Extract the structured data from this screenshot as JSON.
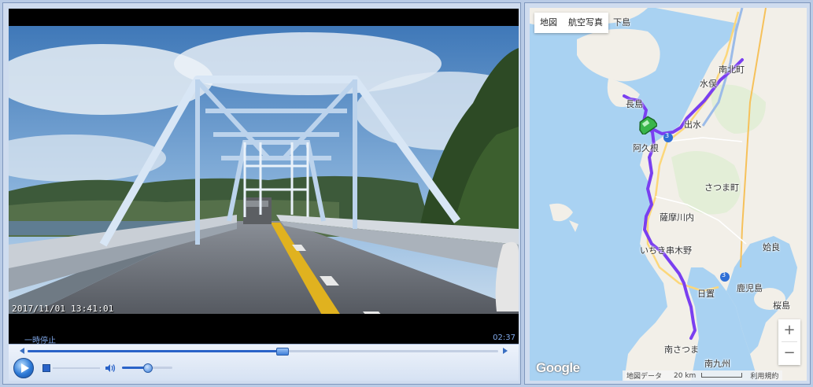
{
  "player": {
    "timestamp_overlay": "2017/11/01  13:41:01",
    "status": "一時停止",
    "duration": "02:37",
    "seek_progress": 0.54,
    "volume_level": 0.5
  },
  "map": {
    "map_types": [
      "地図",
      "航空写真"
    ],
    "places": {
      "shimojima": "下島",
      "nagashima": "長島",
      "minamishimabara": "南北町",
      "mizuho": "水俣",
      "izumi": "出水",
      "akune": "阿久根",
      "satsuma": "さつま町",
      "satsumasendai": "薩摩川内",
      "ichikikushikino": "いちき串木野",
      "aira": "姶良",
      "kagoshima": "鹿児島",
      "hioki": "日置",
      "sakurajima": "桜島",
      "minamisatsuma": "南さつま",
      "minamikyushu": "南九州",
      "road_3_a": "3",
      "road_3_b": "3"
    },
    "zoom_in": "+",
    "zoom_out": "−",
    "google_logo": "Google",
    "attribution": {
      "map_data": "地図データ",
      "scale": "20 km",
      "terms": "利用規約"
    },
    "colors": {
      "route": "#7a3ff0",
      "water": "#a9d2f2",
      "land": "#f2efe8",
      "vehicle": "#39b54a"
    }
  }
}
